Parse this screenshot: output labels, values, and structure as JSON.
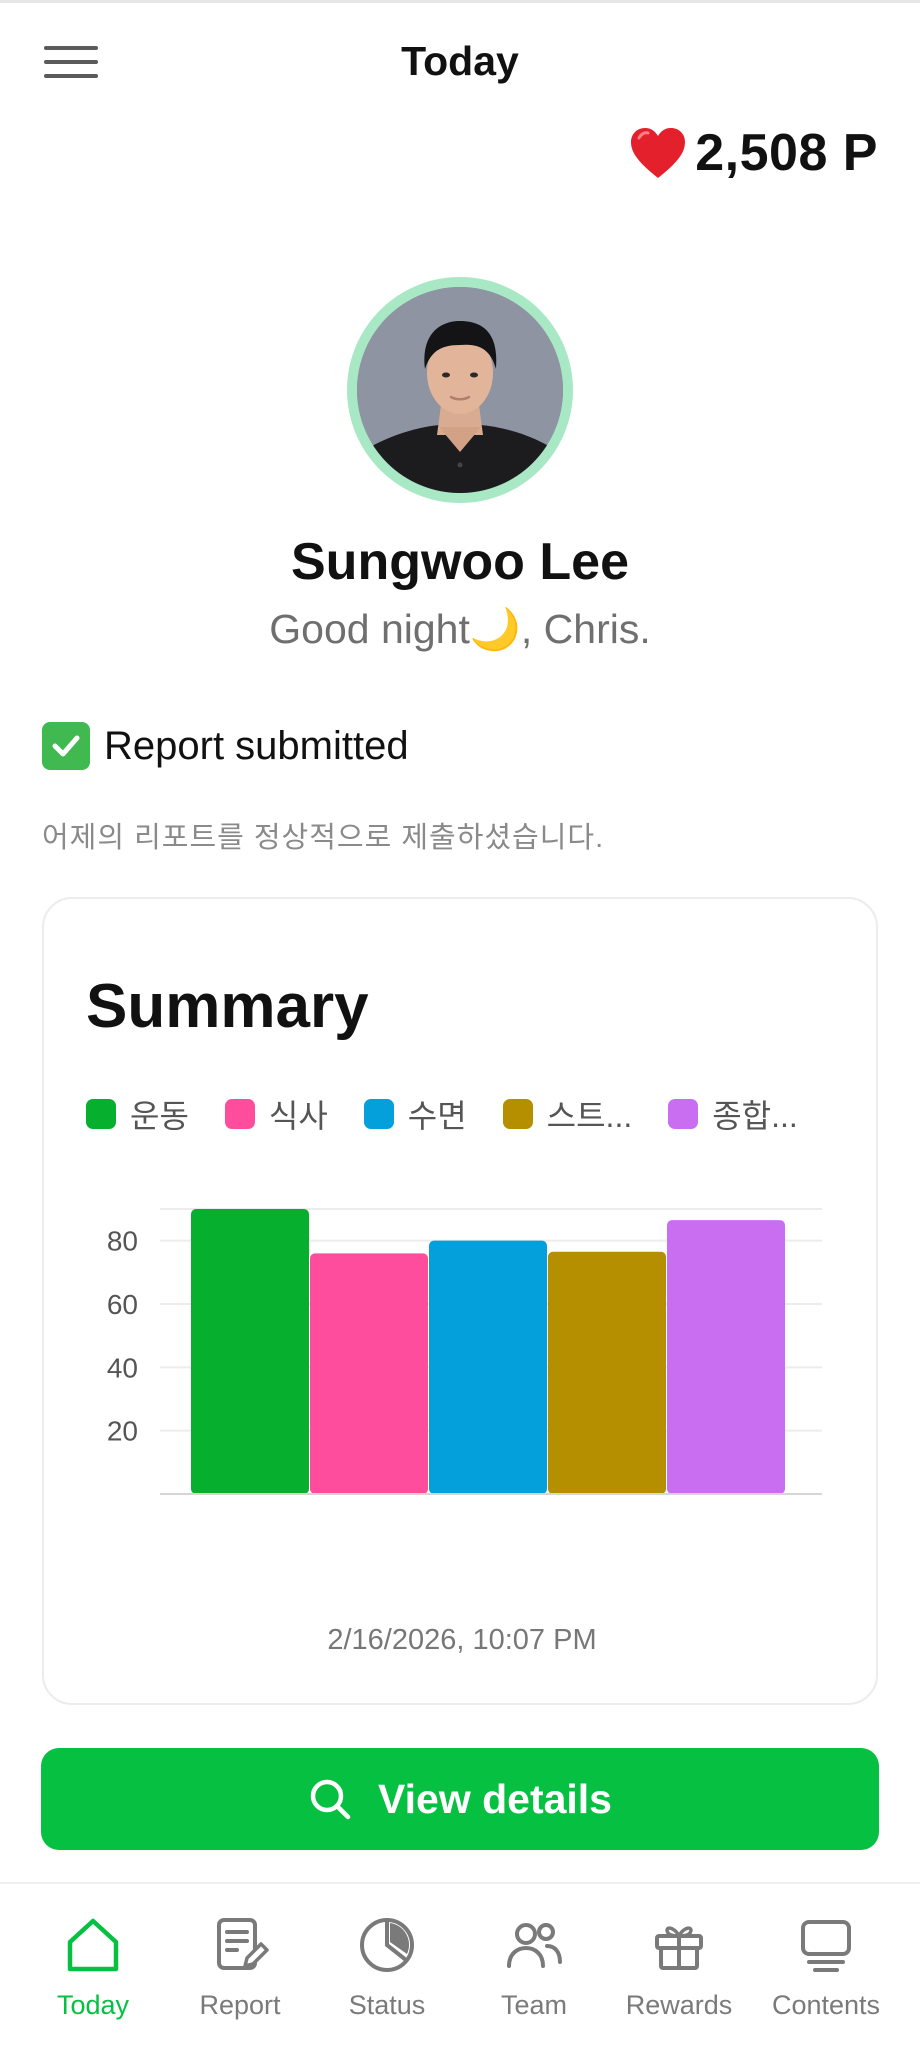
{
  "header": {
    "title": "Today",
    "menu_icon": "hamburger-menu-icon"
  },
  "points": {
    "icon": "heart-icon",
    "value": "2,508 P"
  },
  "profile": {
    "name": "Sungwoo Lee",
    "greeting": "Good night🌙, Chris."
  },
  "report": {
    "icon": "checkmark-icon",
    "status": "Report submitted",
    "description": "어제의 리포트를 정상적으로 제출하셨습니다."
  },
  "summary": {
    "title": "Summary",
    "timestamp": "2/16/2026, 10:07 PM",
    "legend": [
      {
        "label": "운동",
        "color": "#06b02e"
      },
      {
        "label": "식사",
        "color": "#ff4d9e"
      },
      {
        "label": "수면",
        "color": "#03a0dc"
      },
      {
        "label": "스트...",
        "color": "#b58f00"
      },
      {
        "label": "종합...",
        "color": "#c96ef0"
      }
    ]
  },
  "chart_data": {
    "type": "bar",
    "categories": [
      "운동",
      "식사",
      "수면",
      "스트...",
      "종합..."
    ],
    "values": [
      90,
      76,
      80,
      76.5,
      86.5
    ],
    "colors": [
      "#06b02e",
      "#ff4d9e",
      "#03a0dc",
      "#b58f00",
      "#c96ef0"
    ],
    "yticks": [
      20,
      40,
      60,
      80
    ],
    "ylim": [
      0,
      90
    ],
    "grid": true,
    "legend_position": "top"
  },
  "actions": {
    "view_details_label": "View details",
    "view_details_icon": "search-icon"
  },
  "nav": {
    "items": [
      {
        "label": "Today",
        "icon": "home-icon",
        "active": true
      },
      {
        "label": "Report",
        "icon": "report-icon",
        "active": false
      },
      {
        "label": "Status",
        "icon": "pie-chart-icon",
        "active": false
      },
      {
        "label": "Team",
        "icon": "team-icon",
        "active": false
      },
      {
        "label": "Rewards",
        "icon": "gift-icon",
        "active": false
      },
      {
        "label": "Contents",
        "icon": "contents-icon",
        "active": false
      }
    ]
  }
}
